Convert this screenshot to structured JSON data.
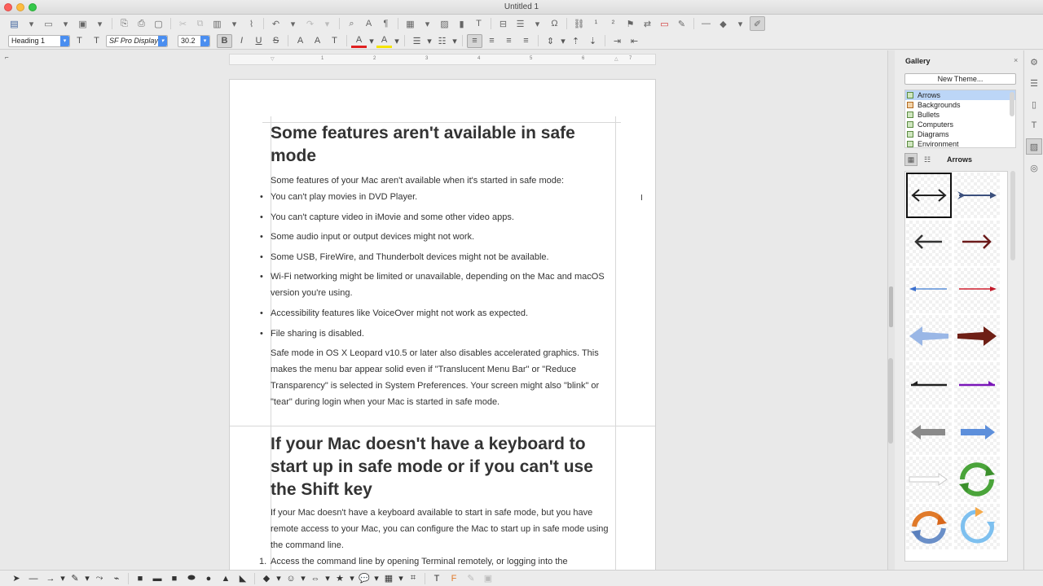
{
  "window": {
    "title": "Untitled 1"
  },
  "toolbar2": {
    "paragraph_style": "Heading 1",
    "font_name": "SF Pro Display",
    "font_size": "30.2"
  },
  "ruler": {
    "numbers": [
      "1",
      "1",
      "2",
      "3",
      "4",
      "5",
      "6",
      "7"
    ]
  },
  "document": {
    "heading1": "Some features aren't available in safe mode",
    "intro": "Some features of your Mac aren't available when it's started in safe mode:",
    "bullets": [
      "You can't play movies in DVD Player.",
      "You can't capture video in iMovie and some other video apps.",
      "Some audio input or output devices might not work.",
      "Some USB, FireWire, and Thunderbolt devices might not be available.",
      "Wi-Fi networking might be limited or unavailable, depending on the Mac and macOS version you're using.",
      "Accessibility features like VoiceOver might not work as expected.",
      "File sharing is disabled."
    ],
    "paragraph2": "Safe mode in OS X Leopard v10.5 or later also disables accelerated graphics. This makes the menu bar appear solid even if \"Translucent Menu Bar\" or \"Reduce Transparency\" is selected in System Preferences. Your screen might also \"blink\" or \"tear\" during login when your Mac is started in safe mode.",
    "heading2": "If your Mac doesn't have a keyboard to start up in safe mode or if you can't use the Shift key",
    "paragraph3": "If your Mac doesn't have a keyboard available to start in safe mode, but you have remote access to your Mac, you can configure the Mac to start up in safe mode using the command line.",
    "numbered": [
      {
        "num": "1.",
        "text": "Access the command line by opening Terminal remotely, or logging into the"
      }
    ]
  },
  "gallery": {
    "title": "Gallery",
    "close": "×",
    "new_theme": "New Theme...",
    "themes": [
      "Arrows",
      "Backgrounds",
      "Bullets",
      "Computers",
      "Diagrams",
      "Environment"
    ],
    "selected_theme": "Arrows",
    "view_label": "Arrows"
  },
  "colors": {
    "accent": "#4a8ef0",
    "selection": "#bcd6f7",
    "font_color_underline": "#e02020",
    "highlight_underline": "#f5e400"
  }
}
